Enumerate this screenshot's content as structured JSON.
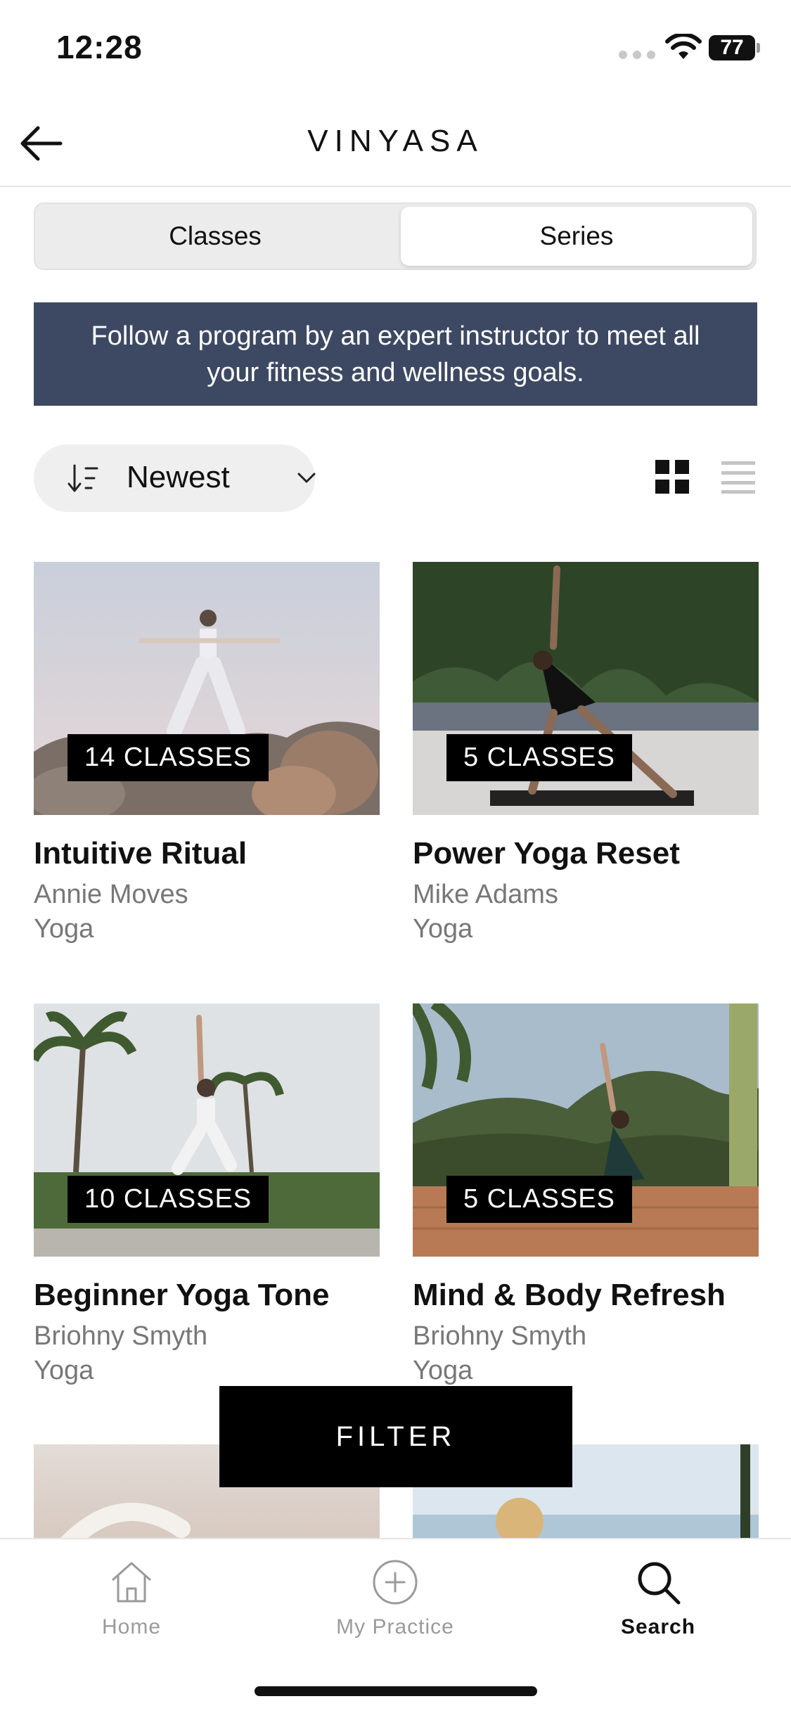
{
  "status": {
    "time": "12:28",
    "battery": "77"
  },
  "header": {
    "title": "VINYASA"
  },
  "tabs": [
    {
      "label": "Classes",
      "selected": false
    },
    {
      "label": "Series",
      "selected": true
    }
  ],
  "banner": {
    "text": "Follow a program by an expert instructor to meet all your fitness and wellness goals."
  },
  "sort": {
    "label": "Newest"
  },
  "cards": [
    {
      "badge": "14 CLASSES",
      "title": "Intuitive Ritual",
      "instructor": "Annie Moves",
      "category": "Yoga"
    },
    {
      "badge": "5 CLASSES",
      "title": "Power Yoga Reset",
      "instructor": "Mike Adams",
      "category": "Yoga"
    },
    {
      "badge": "10 CLASSES",
      "title": "Beginner Yoga Tone",
      "instructor": "Briohny Smyth",
      "category": "Yoga"
    },
    {
      "badge": "5 CLASSES",
      "title": "Mind & Body Refresh",
      "instructor": "Briohny Smyth",
      "category": "Yoga"
    }
  ],
  "filter": {
    "label": "FILTER"
  },
  "tab_bar": [
    {
      "label": "Home",
      "icon": "home-icon",
      "active": false
    },
    {
      "label": "My Practice",
      "icon": "plus-circle-icon",
      "active": false
    },
    {
      "label": "Search",
      "icon": "search-icon",
      "active": true
    }
  ],
  "colors": {
    "banner": "#3d4962",
    "badge": "#000000",
    "muted_text": "#777777"
  }
}
